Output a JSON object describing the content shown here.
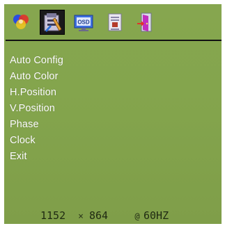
{
  "menu": {
    "items": [
      {
        "label": "Auto Config"
      },
      {
        "label": "Auto Color"
      },
      {
        "label": "H.Position"
      },
      {
        "label": "V.Position"
      },
      {
        "label": "Phase"
      },
      {
        "label": "Clock"
      },
      {
        "label": "Exit"
      }
    ]
  },
  "tabs": [
    {
      "icon": "color-balls-icon"
    },
    {
      "icon": "image-tools-icon",
      "selected": true
    },
    {
      "icon": "osd-monitor-icon"
    },
    {
      "icon": "document-settings-icon"
    },
    {
      "icon": "exit-door-icon"
    }
  ],
  "status": {
    "width": "1152",
    "times": "×",
    "height": "864",
    "at": "@",
    "refresh": "60HZ"
  },
  "colors": {
    "background": "#84a54d",
    "selected_tab": "#1a1a1a",
    "text": "#ffffff"
  }
}
